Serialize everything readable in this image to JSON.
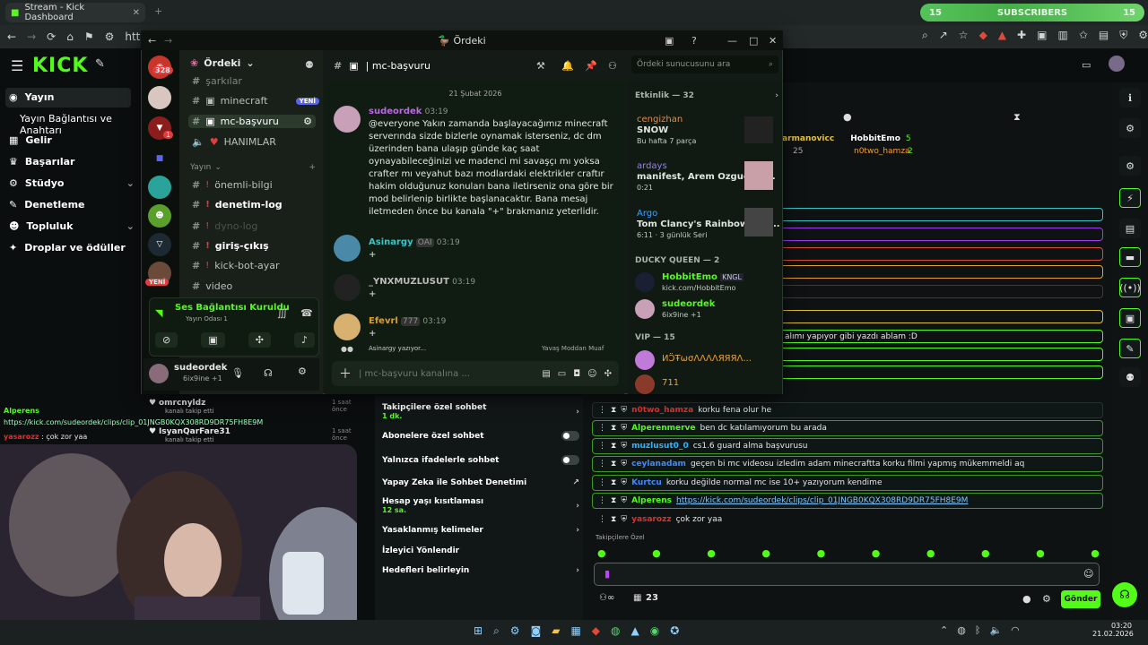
{
  "browser": {
    "tab_title": "Stream - Kick Dashboard",
    "address": "https:",
    "subscribers_left": "15",
    "subscribers_label": "SUBSCRIBERS",
    "subscribers_right": "15"
  },
  "kick": {
    "logo": "KICK",
    "nav": [
      {
        "label": "Yayın"
      },
      {
        "label": "Yayın Bağlantısı ve Anahtarı"
      },
      {
        "label": "Gelir"
      },
      {
        "label": "Başarılar"
      },
      {
        "label": "Stüdyo"
      },
      {
        "label": "Denetleme"
      },
      {
        "label": "Topluluk"
      },
      {
        "label": "Droplar ve ödüller"
      }
    ]
  },
  "discord": {
    "window_title": "Ördeki",
    "server_name": "Ördeki",
    "channel_header": "| mc-başvuru",
    "search_placeholder": "Ördeki sunucusunu ara",
    "server_badge": "328",
    "server_badge2": "1",
    "new_badge": "YENİ",
    "channels": [
      {
        "name": "şarkılar"
      },
      {
        "name": "minecraft",
        "badge": "YENİ"
      },
      {
        "name": "mc-başvuru"
      },
      {
        "name": "HANIMLAR"
      }
    ],
    "category": "Yayın",
    "channels2": [
      {
        "name": "önemli-bilgi"
      },
      {
        "name": "denetim-log"
      },
      {
        "name": "dyno-log"
      },
      {
        "name": "giriş-çıkış"
      },
      {
        "name": "kick-bot-ayar"
      },
      {
        "name": "video"
      }
    ],
    "voice": {
      "title": "Ses Bağlantısı Kuruldu",
      "sub": "Yayın Odası 1"
    },
    "user": {
      "name": "sudeordek",
      "status": "6ix9ine +1"
    },
    "date_divider": "21 Şubat 2026",
    "messages": [
      {
        "name": "sudeordek",
        "time": "03:19",
        "text": "@everyone Yakın zamanda başlayacağımız minecraft serverında sizde bizlerle oynamak isterseniz, dc dm üzerinden bana ulaşıp günde kaç saat oynayabileceğinizi ve madenci mi savaşçı mı yoksa crafter mı veyahut bazı modlardaki elektrikler craftır hakim olduğunuz konuları bana iletirseniz ona göre bir mod belirlenip birlikte başlanacaktır. Bana mesaj iletmeden önce bu kanala \"+\" brakmanız yeterlidir."
      },
      {
        "name": "Asinargy",
        "tag": "OAI",
        "time": "03:19",
        "text": "+"
      },
      {
        "name": "_YNXMUZLUSUT",
        "time": "03:19",
        "text": "+"
      },
      {
        "name": "Efevrl",
        "tag": "777",
        "time": "03:19",
        "text": "+"
      }
    ],
    "typing": "Asinargy yazıyor...",
    "slowmode": "Yavaş Moddan Muaf",
    "composer_placeholder": "| mc-başvuru kanalına ...",
    "members": {
      "activity_header": "Etkinlik — 32",
      "activity": [
        {
          "name": "cengizhan",
          "sub": "SNOW",
          "sub2": "Bu hafta 7 parça"
        },
        {
          "name": "ardays",
          "sub": "manifest, Arem Ozguc, Ar...",
          "sub2": "0:21"
        },
        {
          "name": "Argo",
          "sub": "Tom Clancy's Rainbow Six ...",
          "sub2": "6:11 · 3 günlük Seri"
        }
      ],
      "group1": "DUCKY QUEEN — 2",
      "group1_members": [
        {
          "name": "HobbitEmo",
          "tag": "KNGL",
          "sub": "kick.com/HobbitEmo"
        },
        {
          "name": "sudeordek",
          "sub": "6ix9ine +1"
        }
      ],
      "group2": "VIP — 15",
      "group2_members": [
        {
          "name": "ИƆ̈ŦωσΛΛΛΛЯЯЯΛ..."
        },
        {
          "name": "711"
        }
      ]
    }
  },
  "kick_chat": {
    "top_users": [
      {
        "name": "armanovicc",
        "count": "25"
      },
      {
        "name": "HobbitEmo",
        "count": "5"
      },
      {
        "name": "n0two_hamza",
        "count": "2"
      }
    ],
    "highlight_msg": "alımı yapıyor gibi yazdı ablam :D",
    "rows": [
      {
        "user": "n0two_hamza",
        "text": "korku fena olur he",
        "color": "#e0312b"
      },
      {
        "user": "Alperenmerve",
        "text": "ben dc katılamıyorum bu arada",
        "color": "#53fc18"
      },
      {
        "user": "muzlusut0_0",
        "text": "cs1.6 guard alma başvurusu",
        "color": "#29b6ff"
      },
      {
        "user": "ceylanadam",
        "text": "geçen bi mc videosu izledim adam minecraftta korku filmi yapmış mükemmeldi aq",
        "color": "#3d8bff"
      },
      {
        "user": "Kurtcu",
        "text": "korku değilde normal mc ise 10+ yazıyorum kendime",
        "color": "#3d8bff"
      },
      {
        "user": "Alperens",
        "text": "https://kick.com/sudeordek/clips/clip_01JNGB0KQX308RD9DR75FH8E9M",
        "color": "#53fc18"
      },
      {
        "user": "yasarozz",
        "text": "çok zor yaa",
        "color": "#e0312b"
      }
    ],
    "followers_only": "Takipçilere Özel",
    "send": "Gönder",
    "viewer_count": "23"
  },
  "followers": [
    {
      "name": "omrcnyldz",
      "sub": "kanalı takip etti",
      "time": "1 saat önce"
    },
    {
      "name": "IsyanQarFare31",
      "sub": "kanalı takip etti",
      "time": "1 saat önce"
    }
  ],
  "overlay_chat": [
    {
      "user": "Alperens",
      "text": "https://kick.com/sudeordek/clips/clip_01JNGB0KQX308RD9DR75FH8E9M"
    },
    {
      "user": "yasarozz",
      "text": "çok zor yaa"
    }
  ],
  "mod_options": [
    {
      "label": "Takipçilere özel sohbet",
      "sub": "1 dk.",
      "type": "arrow"
    },
    {
      "label": "Abonelere özel sohbet",
      "type": "toggle"
    },
    {
      "label": "Yalnızca ifadelerle sohbet",
      "type": "toggle"
    },
    {
      "label": "Yapay Zeka ile Sohbet Denetimi",
      "type": "ext"
    },
    {
      "label": "Hesap yaşı kısıtlaması",
      "sub": "12 sa.",
      "type": "arrow"
    },
    {
      "label": "Yasaklanmış kelimeler",
      "type": "arrow"
    },
    {
      "label": "İzleyici Yönlendir",
      "type": "none"
    },
    {
      "label": "Hedefleri belirleyin",
      "type": "arrow"
    }
  ],
  "taskbar": {
    "time": "03:20",
    "date": "21.02.2026"
  },
  "colors": {
    "kick_green": "#53fc18",
    "discord_bg": "#141a16"
  }
}
